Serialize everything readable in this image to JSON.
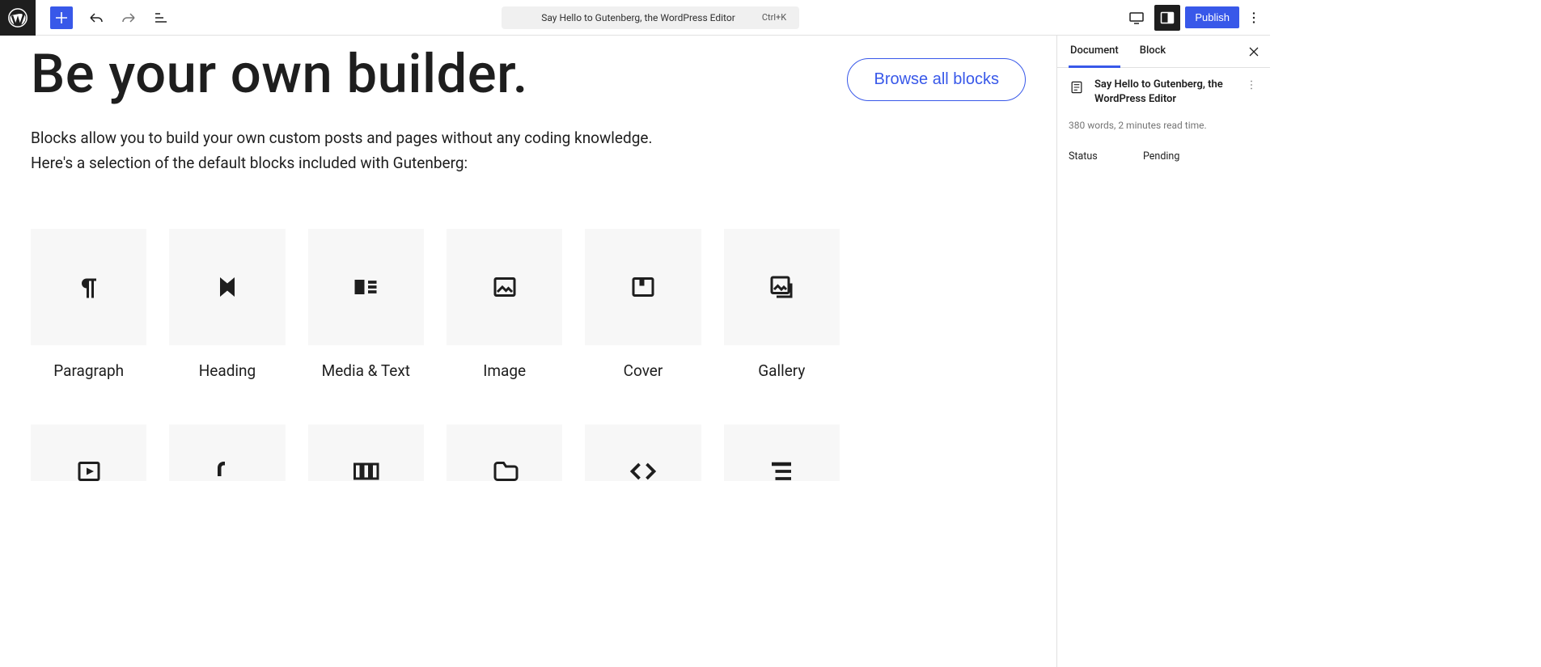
{
  "command_bar": {
    "title": "Say Hello to Gutenberg, the WordPress Editor",
    "shortcut": "Ctrl+K"
  },
  "topbar": {
    "publish": "Publish"
  },
  "content": {
    "heading": "Be your own builder.",
    "browse": "Browse all blocks",
    "lead_line1": "Blocks allow you to build your own custom posts and pages without any coding knowledge.",
    "lead_line2": "Here's a selection of the default blocks included with Gutenberg:"
  },
  "blocks_row1": [
    {
      "name": "Paragraph",
      "icon": "paragraph"
    },
    {
      "name": "Heading",
      "icon": "heading"
    },
    {
      "name": "Media & Text",
      "icon": "media-text"
    },
    {
      "name": "Image",
      "icon": "image"
    },
    {
      "name": "Cover",
      "icon": "cover"
    },
    {
      "name": "Gallery",
      "icon": "gallery"
    }
  ],
  "blocks_row2": [
    {
      "icon": "video"
    },
    {
      "icon": "audio"
    },
    {
      "icon": "columns"
    },
    {
      "icon": "file"
    },
    {
      "icon": "code"
    },
    {
      "icon": "list"
    }
  ],
  "sidebar": {
    "tabs": {
      "document": "Document",
      "block": "Block"
    },
    "doc_title": "Say Hello to Gutenberg, the WordPress Editor",
    "stats": "380 words, 2 minutes read time.",
    "status_label": "Status",
    "status_value": "Pending"
  }
}
